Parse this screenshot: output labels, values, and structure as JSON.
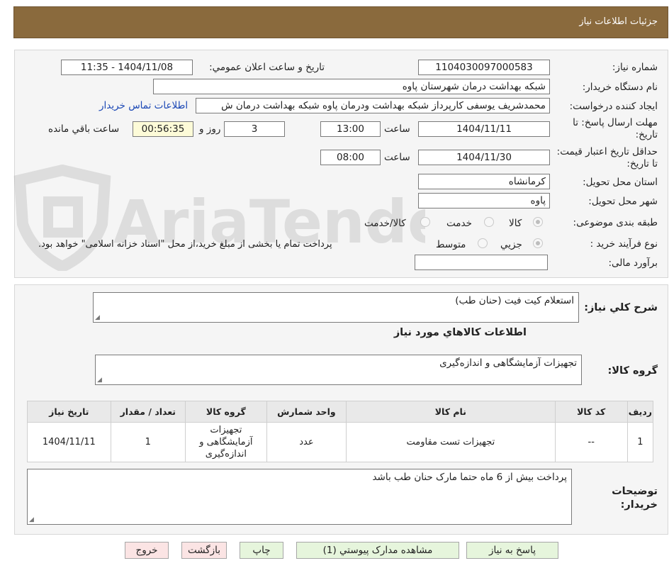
{
  "header": {
    "title": "جزئیات اطلاعات نیاز"
  },
  "watermark": {
    "text": "AriaTender.neT"
  },
  "form": {
    "need_number_label": "شماره نیاز:",
    "need_number": "1104030097000583",
    "announce_label": "تاریخ و ساعت اعلان عمومي:",
    "announce_value": "1404/11/08 - 11:35",
    "buyer_org_label": "نام دستگاه خریدار:",
    "buyer_org": "شبکه بهداشت درمان شهرستان پاوه",
    "requester_label": "ایجاد کننده درخواست:",
    "requester": "محمدشریف یوسفی کارپرداز شبکه بهداشت ودرمان پاوه شبکه بهداشت درمان ش",
    "contact_link": "اطلاعات تماس خریدار",
    "deadline_label": "مهلت ارسال پاسخ: تا تاریخ:",
    "deadline_date": "1404/11/11",
    "time_label": "ساعت",
    "deadline_time": "13:00",
    "days_value": "3",
    "days_label": "روز و",
    "time_left": "00:56:35",
    "time_left_label": "ساعت باقي مانده",
    "validity_label": "حداقل تاریخ اعتبار قیمت: تا تاریخ:",
    "validity_date": "1404/11/30",
    "validity_time_label": "ساعت",
    "validity_time": "08:00",
    "province_label": "استان محل تحویل:",
    "province": "کرمانشاه",
    "city_label": "شهر محل تحویل:",
    "city": "پاوه",
    "category_label": "طبقه بندی موضوعی:",
    "category_options": [
      "کالا",
      "خدمت",
      "کالا/خدمت"
    ],
    "process_label": "نوع فرآیند خرید :",
    "process_options": [
      "جزیي",
      "متوسط"
    ],
    "process_note": "پرداخت تمام یا بخشی از مبلغ خرید،از محل \"اسناد خزانه اسلامی\" خواهد بود.",
    "estimate_label": "برآورد مالی:",
    "estimate_value": ""
  },
  "details": {
    "summary_label": "شرح کلي نیاز:",
    "summary": "استعلام کیت فیت (حنان طب)",
    "goods_info_title": "اطلاعات کالاهاي مورد نیاز",
    "goods_group_label": "گروه کالا:",
    "goods_group": "تجهیزات آزمایشگاهی و اندازه‌گیری",
    "table": {
      "headers": [
        "ردیف",
        "کد کالا",
        "نام کالا",
        "واحد شمارش",
        "گروه کالا",
        "تعداد / مقدار",
        "تاریخ نیاز"
      ],
      "rows": [
        [
          "1",
          "--",
          "تجهیزات تست مقاومت",
          "عدد",
          "تجهیزات آزمایشگاهی و اندازه‌گیری",
          "1",
          "1404/11/11"
        ]
      ]
    },
    "buyer_notes_label": "توضیحات خریدار:",
    "buyer_notes": "پرداخت بیش از 6 ماه حتما مارک حنان طب باشد"
  },
  "buttons": {
    "respond": "پاسخ به نیاز",
    "attachments": "مشاهده مدارک پیوستي (1)",
    "print": "چاپ",
    "back": "بازگشت",
    "exit": "خروج"
  }
}
